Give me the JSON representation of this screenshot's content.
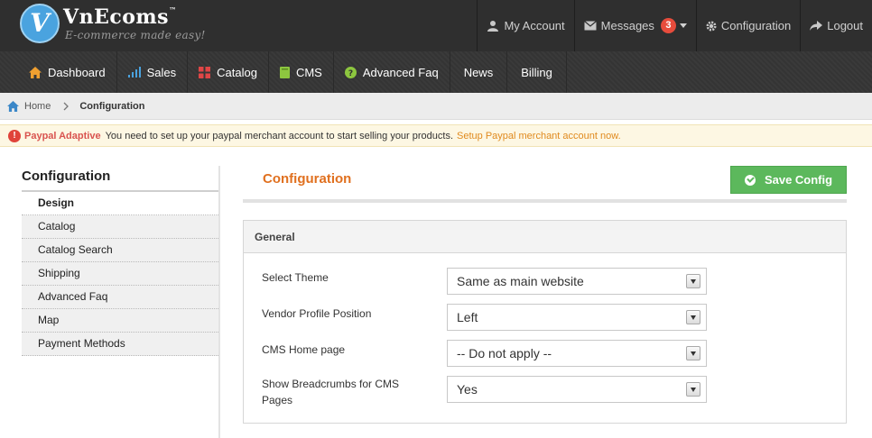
{
  "brand": {
    "name": "VnEcoms",
    "tm": "™",
    "tagline": "E-commerce made easy!",
    "accent": "#4aa3df"
  },
  "toplinks": {
    "account": "My Account",
    "messages": "Messages",
    "messages_count": "3",
    "configuration": "Configuration",
    "logout": "Logout"
  },
  "nav": {
    "items": [
      {
        "label": "Dashboard",
        "icon": "home-icon"
      },
      {
        "label": "Sales",
        "icon": "bar-chart-icon"
      },
      {
        "label": "Catalog",
        "icon": "grid-icon"
      },
      {
        "label": "CMS",
        "icon": "book-icon"
      },
      {
        "label": "Advanced Faq",
        "icon": "question-icon"
      },
      {
        "label": "News",
        "icon": ""
      },
      {
        "label": "Billing",
        "icon": ""
      }
    ]
  },
  "breadcrumb": {
    "home": "Home",
    "current": "Configuration"
  },
  "notice": {
    "title": "Paypal Adaptive",
    "text": "You need to set up your paypal merchant account to start selling your products.",
    "link": "Setup Paypal merchant account now."
  },
  "sidebar": {
    "title": "Configuration",
    "items": [
      {
        "label": "Design",
        "active": true
      },
      {
        "label": "Catalog"
      },
      {
        "label": "Catalog Search"
      },
      {
        "label": "Shipping"
      },
      {
        "label": "Advanced Faq"
      },
      {
        "label": "Map"
      },
      {
        "label": "Payment Methods"
      }
    ]
  },
  "main": {
    "title": "Configuration",
    "save_label": "Save Config",
    "panel_title": "General",
    "fields": [
      {
        "label": "Select Theme",
        "value": "Same as main website"
      },
      {
        "label": "Vendor Profile Position",
        "value": "Left"
      },
      {
        "label": "CMS Home page",
        "value": "-- Do not apply --"
      },
      {
        "label": "Show Breadcrumbs for CMS Pages",
        "value": "Yes"
      }
    ]
  },
  "colors": {
    "save": "#5cb85c",
    "title": "#e0701f",
    "notice_link": "#e08a1e",
    "badge": "#e74c3c"
  }
}
